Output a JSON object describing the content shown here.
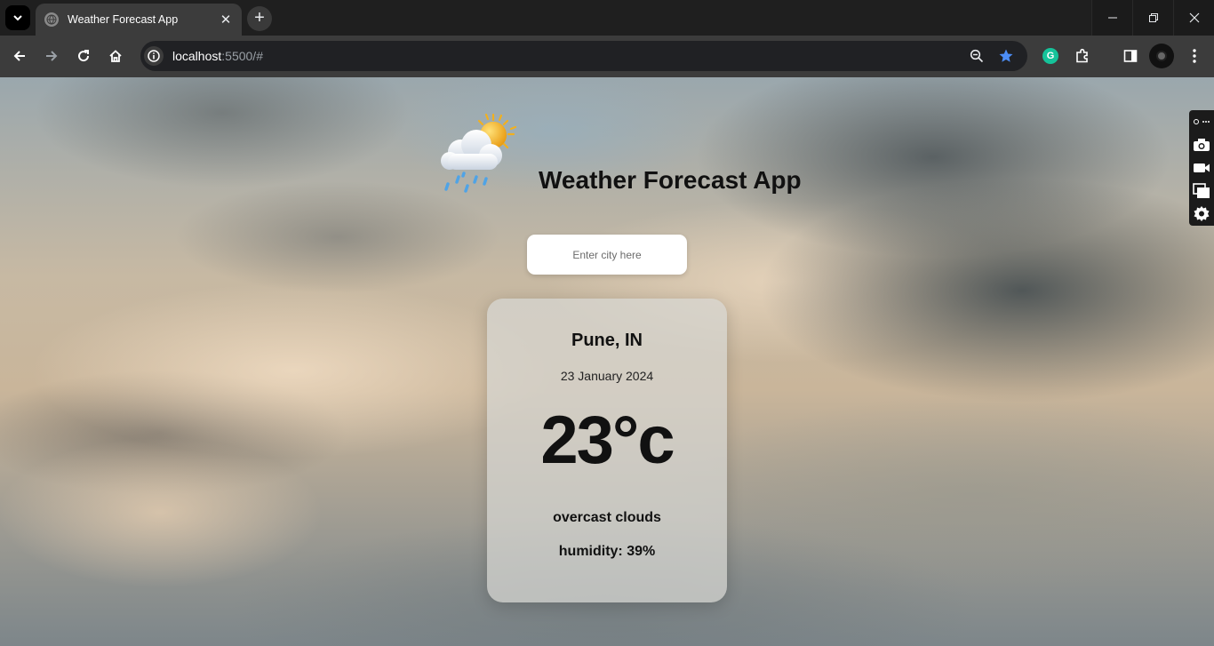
{
  "browser": {
    "tab_title": "Weather Forecast App",
    "url_host": "localhost",
    "url_rest": ":5500/#",
    "grammarly_letter": "G"
  },
  "app": {
    "title": "Weather Forecast App",
    "search_placeholder": "Enter city here"
  },
  "weather": {
    "city": "Pune, IN",
    "date": "23 January 2024",
    "temperature": "23°c",
    "description": "overcast clouds",
    "humidity": "humidity: 39%"
  },
  "colors": {
    "accent_star": "#4c8df6",
    "toolbar": "#3c3c3c",
    "grammarly": "#15c39a"
  }
}
